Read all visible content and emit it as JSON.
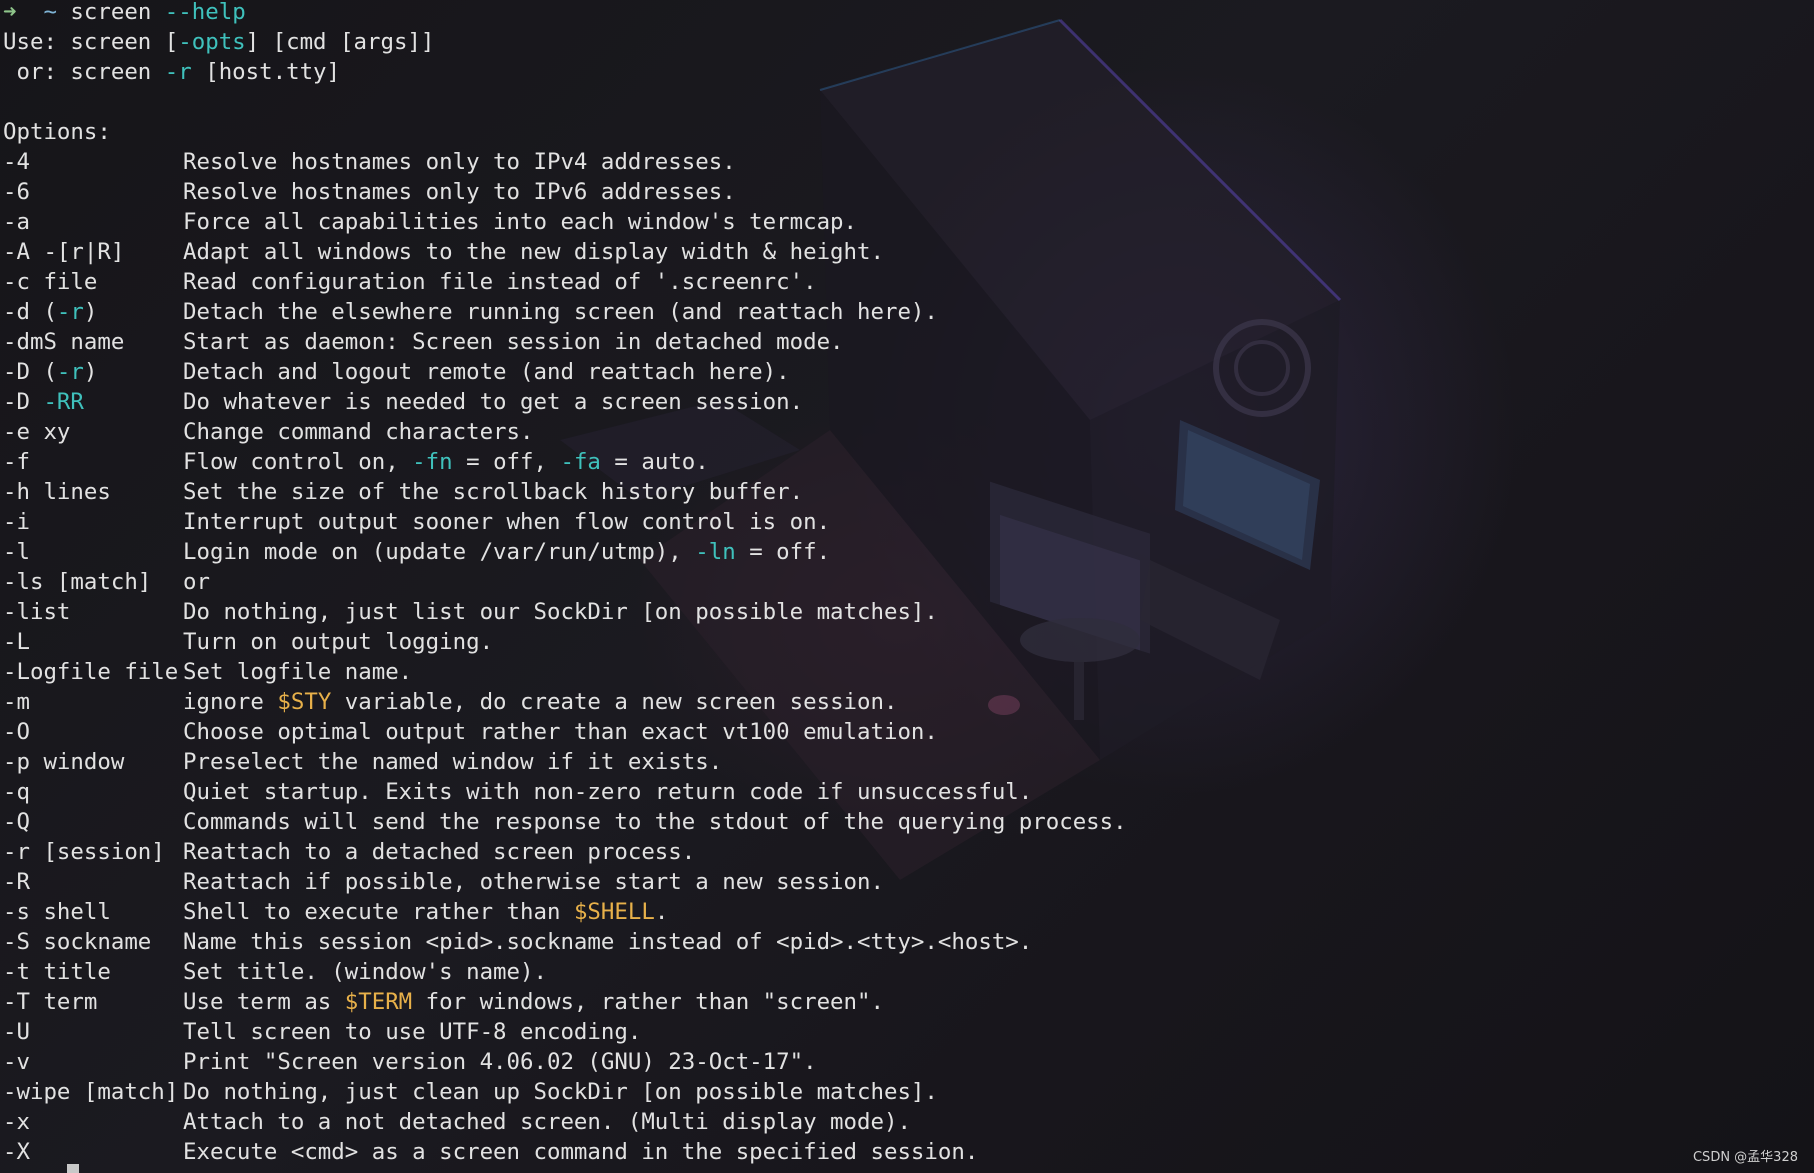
{
  "prompt": {
    "arrow": "➜",
    "tilde": "~",
    "command": "screen",
    "flag": "--help"
  },
  "usage": {
    "line1_pre": "Use: screen [",
    "line1_opt": "-opts",
    "line1_post": "] [cmd [args]]",
    "line2_pre": " or: screen ",
    "line2_opt": "-r",
    "line2_post": " [host.tty]"
  },
  "options_header": "Options:",
  "options": [
    {
      "opt": "-4",
      "desc": "Resolve hostnames only to IPv4 addresses."
    },
    {
      "opt": "-6",
      "desc": "Resolve hostnames only to IPv6 addresses."
    },
    {
      "opt": "-a",
      "desc": "Force all capabilities into each window's termcap."
    },
    {
      "opt": "-A -[r|R]",
      "desc": "Adapt all windows to the new display width & height."
    },
    {
      "opt": "-c file",
      "desc": "Read configuration file instead of '.screenrc'."
    },
    {
      "opt_pre": "-d (",
      "opt_hl": "-r",
      "opt_post": ")",
      "desc": "Detach the elsewhere running screen (and reattach here)."
    },
    {
      "opt": "-dmS name",
      "desc": "Start as daemon: Screen session in detached mode."
    },
    {
      "opt_pre": "-D (",
      "opt_hl": "-r",
      "opt_post": ")",
      "desc": "Detach and logout remote (and reattach here)."
    },
    {
      "opt_pre": "-D ",
      "opt_hl": "-RR",
      "opt_post": "",
      "desc": "Do whatever is needed to get a screen session."
    },
    {
      "opt": "-e xy",
      "desc": "Change command characters."
    },
    {
      "opt": "-f",
      "desc_parts": [
        {
          "t": "Flow control on, ",
          "c": ""
        },
        {
          "t": "-fn",
          "c": "cyan"
        },
        {
          "t": " = off, ",
          "c": ""
        },
        {
          "t": "-fa",
          "c": "cyan"
        },
        {
          "t": " = auto.",
          "c": ""
        }
      ]
    },
    {
      "opt": "-h lines",
      "desc": "Set the size of the scrollback history buffer."
    },
    {
      "opt": "-i",
      "desc": "Interrupt output sooner when flow control is on."
    },
    {
      "opt": "-l",
      "desc_parts": [
        {
          "t": "Login mode on (update /var/run/utmp), ",
          "c": ""
        },
        {
          "t": "-ln",
          "c": "cyan"
        },
        {
          "t": " = off.",
          "c": ""
        }
      ]
    },
    {
      "opt": "-ls [match]",
      "desc": "or"
    },
    {
      "opt": "-list",
      "desc": "Do nothing, just list our SockDir [on possible matches]."
    },
    {
      "opt": "-L",
      "desc": "Turn on output logging."
    },
    {
      "opt": "-Logfile file",
      "desc": "Set logfile name."
    },
    {
      "opt": "-m",
      "desc_parts": [
        {
          "t": "ignore ",
          "c": ""
        },
        {
          "t": "$STY",
          "c": "yellow"
        },
        {
          "t": " variable, do create a new screen session.",
          "c": ""
        }
      ]
    },
    {
      "opt": "-O",
      "desc": "Choose optimal output rather than exact vt100 emulation."
    },
    {
      "opt": "-p window",
      "desc": "Preselect the named window if it exists."
    },
    {
      "opt": "-q",
      "desc": "Quiet startup. Exits with non-zero return code if unsuccessful."
    },
    {
      "opt": "-Q",
      "desc": "Commands will send the response to the stdout of the querying process."
    },
    {
      "opt": "-r [session]",
      "desc": "Reattach to a detached screen process."
    },
    {
      "opt": "-R",
      "desc": "Reattach if possible, otherwise start a new session."
    },
    {
      "opt": "-s shell",
      "desc_parts": [
        {
          "t": "Shell to execute rather than ",
          "c": ""
        },
        {
          "t": "$SHELL",
          "c": "yellow"
        },
        {
          "t": ".",
          "c": ""
        }
      ]
    },
    {
      "opt": "-S sockname",
      "desc": "Name this session <pid>.sockname instead of <pid>.<tty>.<host>."
    },
    {
      "opt": "-t title",
      "desc": "Set title. (window's name)."
    },
    {
      "opt": "-T term",
      "desc_parts": [
        {
          "t": "Use term as ",
          "c": ""
        },
        {
          "t": "$TERM",
          "c": "yellow"
        },
        {
          "t": " for windows, rather than \"screen\".",
          "c": ""
        }
      ]
    },
    {
      "opt": "-U",
      "desc": "Tell screen to use UTF-8 encoding."
    },
    {
      "opt": "-v",
      "desc": "Print \"Screen version 4.06.02 (GNU) 23-Oct-17\"."
    },
    {
      "opt": "-wipe [match]",
      "desc": "Do nothing, just clean up SockDir [on possible matches]."
    },
    {
      "opt": "-x",
      "desc": "Attach to a not detached screen. (Multi display mode)."
    },
    {
      "opt": "-X",
      "desc": "Execute <cmd> as a screen command in the specified session."
    }
  ],
  "watermark": "CSDN @孟华328",
  "colors": {
    "background": "#141317",
    "text": "#e2e2e2",
    "flag_highlight": "#3fc1bc",
    "variable_highlight": "#e8b14a",
    "prompt_arrow": "#8ec48a",
    "prompt_tilde": "#7fb4d6"
  }
}
